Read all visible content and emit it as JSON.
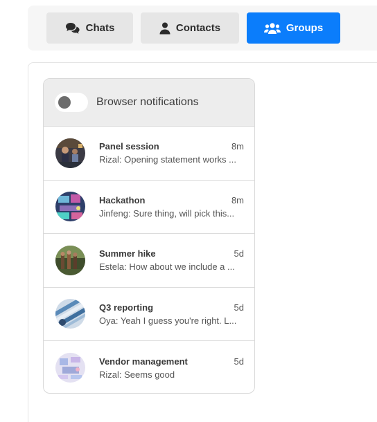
{
  "tabs": [
    {
      "label": "Chats",
      "icon": "chats-icon"
    },
    {
      "label": "Contacts",
      "icon": "contact-icon"
    },
    {
      "label": "Groups",
      "icon": "groups-icon",
      "active": true
    }
  ],
  "colors": {
    "accent": "#0b7dfb",
    "tab_bg": "#e6e6e6"
  },
  "notifications": {
    "label": "Browser notifications",
    "enabled": false
  },
  "groups": [
    {
      "name": "Panel session",
      "time": "8m",
      "message": "Rizal: Opening statement works ..."
    },
    {
      "name": "Hackathon",
      "time": "8m",
      "message": "Jinfeng: Sure thing, will pick this..."
    },
    {
      "name": "Summer hike",
      "time": "5d",
      "message": "Estela: How about we include a ..."
    },
    {
      "name": "Q3 reporting",
      "time": "5d",
      "message": "Oya: Yeah I guess you're right. L..."
    },
    {
      "name": "Vendor management",
      "time": "5d",
      "message": "Rizal: Seems good"
    }
  ]
}
